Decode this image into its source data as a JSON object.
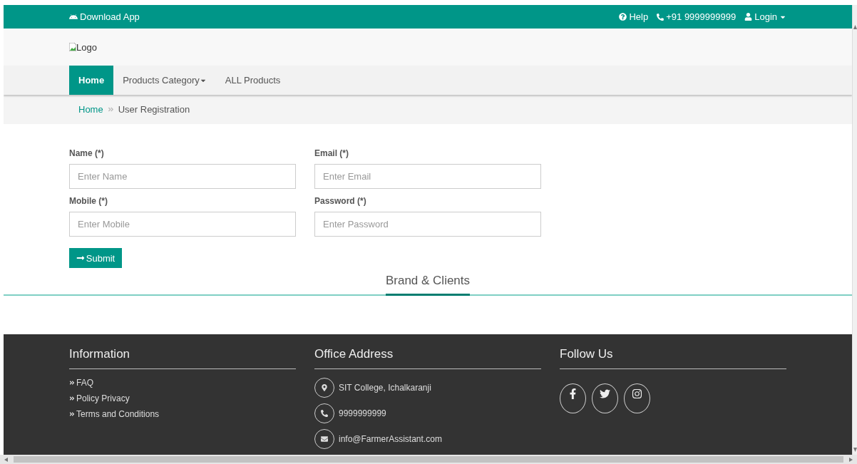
{
  "top_bar": {
    "download": "Download App",
    "help": "Help",
    "phone": "+91 9999999999",
    "login": "Login"
  },
  "logo": {
    "alt": "Logo"
  },
  "nav": [
    {
      "label": "Home",
      "selected": true,
      "dropdown": false
    },
    {
      "label": "Products Category",
      "selected": false,
      "dropdown": true
    },
    {
      "label": "ALL Products",
      "selected": false,
      "dropdown": false
    }
  ],
  "breadcrumb": [
    {
      "label": "Home",
      "link": true
    },
    {
      "label": "User Registration",
      "link": false
    }
  ],
  "form": {
    "fields": [
      {
        "label": "Name (*)",
        "placeholder": "Enter Name"
      },
      {
        "label": "Email (*)",
        "placeholder": "Enter Email"
      },
      {
        "label": "Mobile (*)",
        "placeholder": "Enter Mobile"
      },
      {
        "label": "Password (*)",
        "placeholder": "Enter Password"
      }
    ],
    "submit": "Submit"
  },
  "brand_heading": "Brand & Clients",
  "footer": {
    "information": {
      "title": "Information",
      "links": [
        "FAQ",
        "Policy Privacy",
        "Terms and Conditions"
      ]
    },
    "office": {
      "title": "Office Address",
      "items": [
        {
          "kind": "address",
          "text": "SIT College, Ichalkaranji"
        },
        {
          "kind": "phone",
          "text": "9999999999"
        },
        {
          "kind": "email",
          "text": "info@FarmerAssistant.com"
        }
      ]
    },
    "follow": {
      "title": "Follow Us",
      "socials": [
        {
          "kind": "facebook"
        },
        {
          "kind": "twitter"
        },
        {
          "kind": "instagram"
        }
      ]
    }
  }
}
